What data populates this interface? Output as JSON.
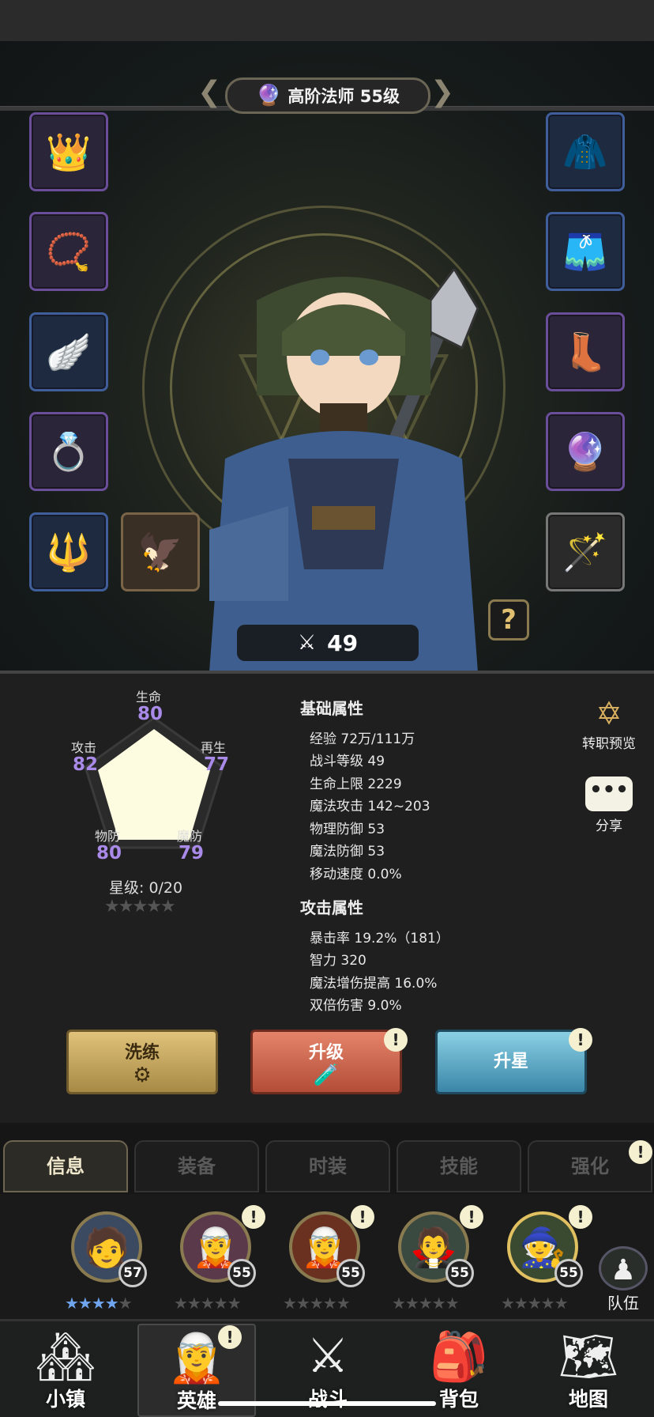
{
  "header": {
    "title": "高阶法师 55级"
  },
  "equipment": {
    "left": [
      "crown-icon",
      "necklace-icon",
      "wing-bracelet-icon",
      "ring-icon",
      "spear-icon"
    ],
    "extra": "claw-icon",
    "right": [
      "cape-icon",
      "pants-icon",
      "boots-icon",
      "orb-ring-icon",
      "staff-icon"
    ]
  },
  "power": {
    "value": "49"
  },
  "help": {
    "label": "?"
  },
  "radar": {
    "life": {
      "label": "生命",
      "value": "80"
    },
    "attack": {
      "label": "攻击",
      "value": "82"
    },
    "regen": {
      "label": "再生",
      "value": "77"
    },
    "pdef": {
      "label": "物防",
      "value": "80"
    },
    "mdef": {
      "label": "魔防",
      "value": "79"
    },
    "star_level": "星级: 0/20",
    "stars": "★★★★★"
  },
  "basic": {
    "title": "基础属性",
    "items": [
      "经验 72万/111万",
      "战斗等级 49",
      "生命上限 2229",
      "魔法攻击 142~203",
      "物理防御 53",
      "魔法防御 53",
      "移动速度 0.0%"
    ]
  },
  "attack": {
    "title": "攻击属性",
    "items": [
      "暴击率 19.2%（181）",
      "智力 320",
      "魔法增伤提高 16.0%",
      "双倍伤害 9.0%"
    ]
  },
  "side": {
    "job_preview": "转职预览",
    "share": "分享",
    "share_glyph": "•••"
  },
  "actions": {
    "xilian": "洗练",
    "shengji": "升级",
    "shengxing": "升星",
    "alert": "!"
  },
  "tabs": [
    "信息",
    "装备",
    "时装",
    "技能",
    "强化"
  ],
  "heroes": [
    {
      "level": "57",
      "stars_on": 4
    },
    {
      "level": "55",
      "stars_on": 0
    },
    {
      "level": "55",
      "stars_on": 0
    },
    {
      "level": "55",
      "stars_on": 0
    },
    {
      "level": "55",
      "stars_on": 0
    }
  ],
  "team": {
    "label": "队伍"
  },
  "nav": [
    "小镇",
    "英雄",
    "战斗",
    "背包",
    "地图"
  ],
  "colors": {
    "stat_value": "#a98ae8",
    "star_on": "#6fa5ef"
  }
}
